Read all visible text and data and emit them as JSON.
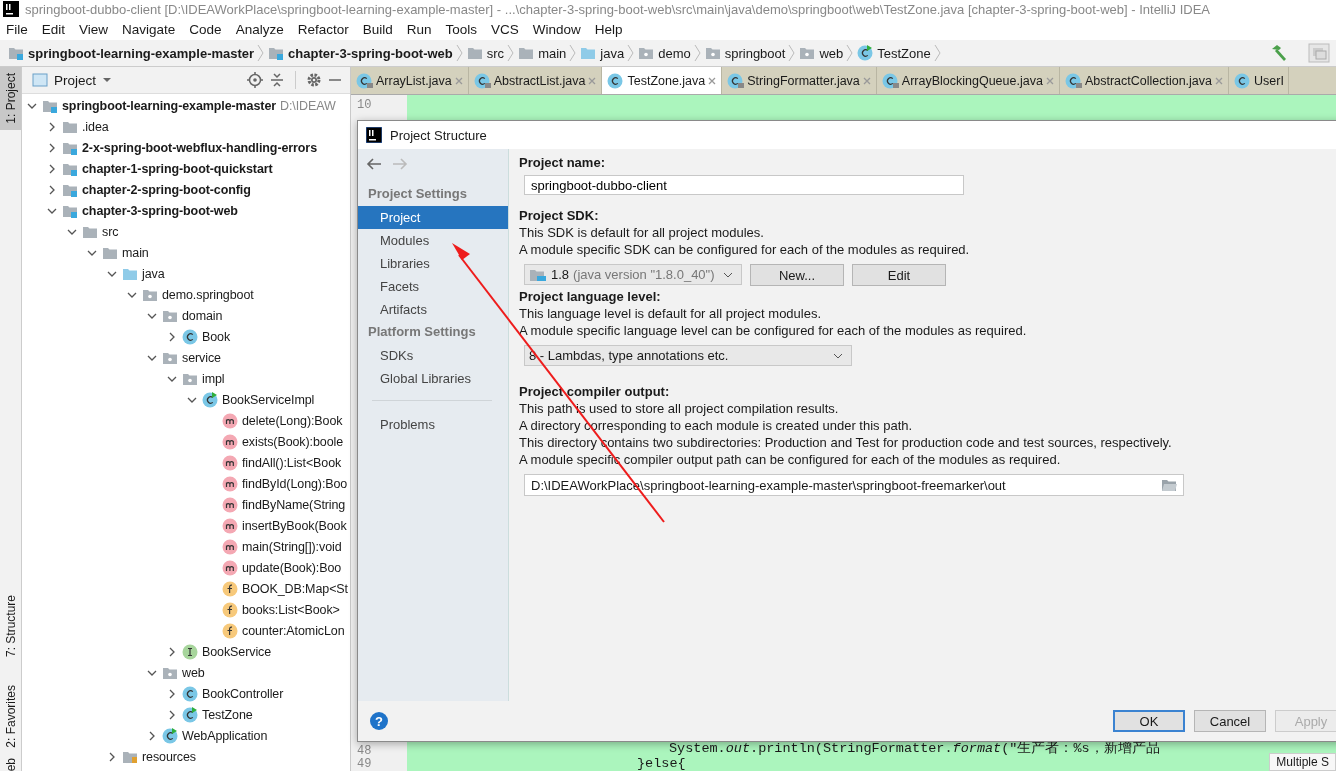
{
  "window": {
    "title": "springboot-dubbo-client [D:\\IDEAWorkPlace\\springboot-learning-example-master] - ...\\chapter-3-spring-boot-web\\src\\main\\java\\demo\\springboot\\web\\TestZone.java [chapter-3-spring-boot-web] - IntelliJ IDEA"
  },
  "menu": [
    "File",
    "Edit",
    "View",
    "Navigate",
    "Code",
    "Analyze",
    "Refactor",
    "Build",
    "Run",
    "Tools",
    "VCS",
    "Window",
    "Help"
  ],
  "breadcrumb": [
    {
      "label": "springboot-learning-example-master",
      "kind": "module"
    },
    {
      "label": "chapter-3-spring-boot-web",
      "kind": "module"
    },
    {
      "label": "src",
      "kind": "folder"
    },
    {
      "label": "main",
      "kind": "folder"
    },
    {
      "label": "java",
      "kind": "source"
    },
    {
      "label": "demo",
      "kind": "package"
    },
    {
      "label": "springboot",
      "kind": "package"
    },
    {
      "label": "web",
      "kind": "package"
    },
    {
      "label": "TestZone",
      "kind": "class-run"
    }
  ],
  "tool_stripe": [
    {
      "label": "1: Project",
      "selected": true
    },
    {
      "label": "7: Structure",
      "selected": false
    },
    {
      "label": "2: Favorites",
      "selected": false
    },
    {
      "label": "eb",
      "selected": false
    }
  ],
  "project_panel": {
    "title": "Project"
  },
  "project_tree": [
    {
      "label": "springboot-learning-example-master",
      "hint": "D:\\IDEAW",
      "kind": "module",
      "expanded": true,
      "children": [
        {
          "label": ".idea",
          "kind": "folder",
          "expanded": false
        },
        {
          "label": "2-x-spring-boot-webflux-handling-errors",
          "kind": "module",
          "expanded": false
        },
        {
          "label": "chapter-1-spring-boot-quickstart",
          "kind": "module",
          "expanded": false
        },
        {
          "label": "chapter-2-spring-boot-config",
          "kind": "module",
          "expanded": false
        },
        {
          "label": "chapter-3-spring-boot-web",
          "kind": "module",
          "expanded": true,
          "children": [
            {
              "label": "src",
              "kind": "folder",
              "expanded": true,
              "children": [
                {
                  "label": "main",
                  "kind": "folder",
                  "expanded": true,
                  "children": [
                    {
                      "label": "java",
                      "kind": "source",
                      "expanded": true,
                      "children": [
                        {
                          "label": "demo.springboot",
                          "kind": "package",
                          "expanded": true,
                          "children": [
                            {
                              "label": "domain",
                              "kind": "package",
                              "expanded": true,
                              "children": [
                                {
                                  "label": "Book",
                                  "kind": "class",
                                  "expanded": false
                                }
                              ]
                            },
                            {
                              "label": "service",
                              "kind": "package",
                              "expanded": true,
                              "children": [
                                {
                                  "label": "impl",
                                  "kind": "package",
                                  "expanded": true,
                                  "children": [
                                    {
                                      "label": "BookServiceImpl",
                                      "kind": "class-run",
                                      "expanded": true,
                                      "children": [
                                        {
                                          "label": "delete(Long):Book",
                                          "kind": "method"
                                        },
                                        {
                                          "label": "exists(Book):boole",
                                          "kind": "method"
                                        },
                                        {
                                          "label": "findAll():List<Book",
                                          "kind": "method"
                                        },
                                        {
                                          "label": "findById(Long):Boo",
                                          "kind": "method"
                                        },
                                        {
                                          "label": "findByName(String",
                                          "kind": "method"
                                        },
                                        {
                                          "label": "insertByBook(Book",
                                          "kind": "method"
                                        },
                                        {
                                          "label": "main(String[]):void",
                                          "kind": "method"
                                        },
                                        {
                                          "label": "update(Book):Boo",
                                          "kind": "method"
                                        },
                                        {
                                          "label": "BOOK_DB:Map<St",
                                          "kind": "field"
                                        },
                                        {
                                          "label": "books:List<Book>",
                                          "kind": "field"
                                        },
                                        {
                                          "label": "counter:AtomicLon",
                                          "kind": "field"
                                        }
                                      ]
                                    }
                                  ]
                                },
                                {
                                  "label": "BookService",
                                  "kind": "interface",
                                  "expanded": false
                                }
                              ]
                            },
                            {
                              "label": "web",
                              "kind": "package",
                              "expanded": true,
                              "children": [
                                {
                                  "label": "BookController",
                                  "kind": "class",
                                  "expanded": false
                                },
                                {
                                  "label": "TestZone",
                                  "kind": "class-run",
                                  "expanded": false
                                }
                              ]
                            },
                            {
                              "label": "WebApplication",
                              "kind": "app",
                              "expanded": false
                            }
                          ]
                        }
                      ]
                    },
                    {
                      "label": "resources",
                      "kind": "resources",
                      "expanded": false
                    }
                  ]
                }
              ]
            }
          ]
        }
      ]
    }
  ],
  "tabs": [
    {
      "label": "ArrayList.java",
      "selected": false,
      "locked": true
    },
    {
      "label": "AbstractList.java",
      "selected": false,
      "locked": true
    },
    {
      "label": "TestZone.java",
      "selected": true,
      "locked": false
    },
    {
      "label": "StringFormatter.java",
      "selected": false,
      "locked": true
    },
    {
      "label": "ArrayBlockingQueue.java",
      "selected": false,
      "locked": true
    },
    {
      "label": "AbstractCollection.java",
      "selected": false,
      "locked": true
    },
    {
      "label": "UserI",
      "selected": false,
      "locked": false
    }
  ],
  "editor": {
    "top_lines": [
      {
        "number": "10"
      }
    ],
    "bottom_lines": [
      {
        "number": "48",
        "code": "System.*out*.println(StringFormatter.*format*(\"生产者：%s，新增产品",
        "kind": "statement"
      },
      {
        "number": "49",
        "code": "}else{",
        "kind": "brace"
      }
    ],
    "popup": "Multiple S"
  },
  "dialog": {
    "title": "Project Structure",
    "nav": [
      {
        "title": "Project Settings",
        "items": [
          {
            "label": "Project",
            "selected": true
          },
          {
            "label": "Modules",
            "selected": false
          },
          {
            "label": "Libraries",
            "selected": false
          },
          {
            "label": "Facets",
            "selected": false
          },
          {
            "label": "Artifacts",
            "selected": false
          }
        ]
      },
      {
        "title": "Platform Settings",
        "items": [
          {
            "label": "SDKs",
            "selected": false
          },
          {
            "label": "Global Libraries",
            "selected": false
          }
        ]
      }
    ],
    "nav_footer": [
      {
        "label": "Problems",
        "selected": false
      }
    ],
    "project_name": {
      "label": "Project name:",
      "value": "springboot-dubbo-client"
    },
    "sdk": {
      "label": "Project SDK:",
      "lines": [
        "This SDK is default for all project modules.",
        "A module specific SDK can be configured for each of the modules as required."
      ],
      "value": "1.8",
      "detail": "(java version \"1.8.0_40\")",
      "buttons": [
        "New...",
        "Edit"
      ]
    },
    "language_level": {
      "label": "Project language level:",
      "lines": [
        "This language level is default for all project modules.",
        "A module specific language level can be configured for each of the modules as required."
      ],
      "value": "8 - Lambdas, type annotations etc."
    },
    "compiler_output": {
      "label": "Project compiler output:",
      "lines": [
        "This path is used to store all project compilation results.",
        "A directory corresponding to each module is created under this path.",
        "This directory contains two subdirectories: Production and Test for production code and test sources, respectively.",
        "A module specific compiler output path can be configured for each of the modules as required."
      ],
      "value": "D:\\IDEAWorkPlace\\springboot-learning-example-master\\springboot-freemarker\\out"
    },
    "help": "?",
    "buttons": [
      {
        "label": "OK",
        "default": true,
        "disabled": false
      },
      {
        "label": "Cancel",
        "default": false,
        "disabled": false
      },
      {
        "label": "Apply",
        "default": false,
        "disabled": true
      }
    ]
  }
}
